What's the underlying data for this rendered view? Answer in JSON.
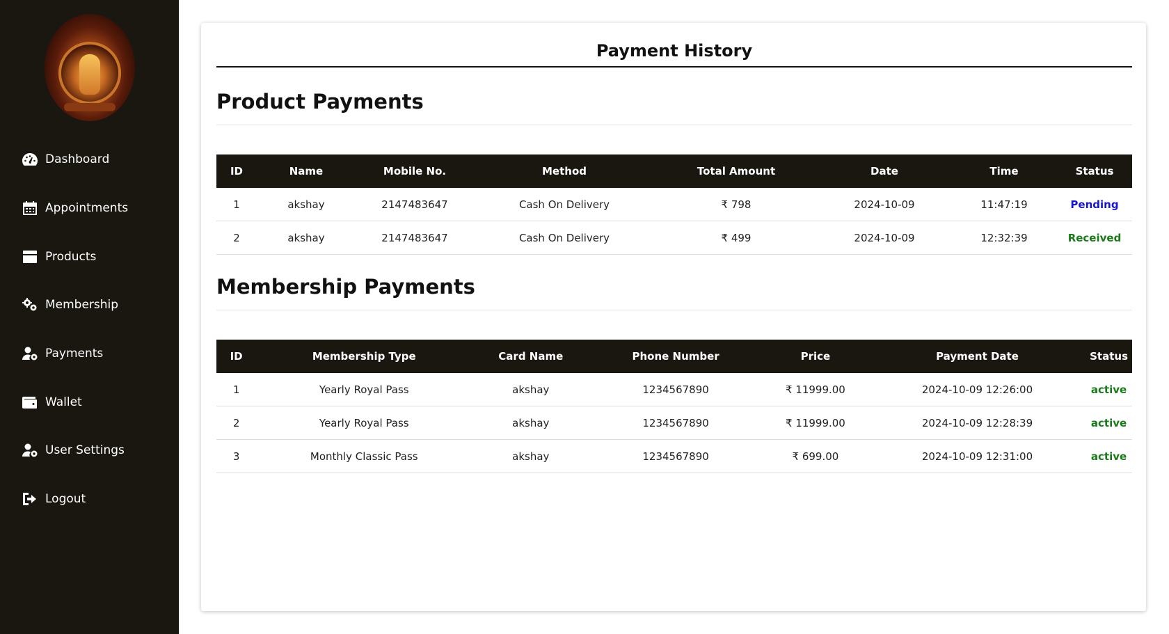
{
  "sidebar": {
    "items": [
      {
        "label": "Dashboard",
        "icon": "gauge-icon"
      },
      {
        "label": "Appointments",
        "icon": "calendar-icon"
      },
      {
        "label": "Products",
        "icon": "box-icon"
      },
      {
        "label": "Membership",
        "icon": "gears-icon"
      },
      {
        "label": "Payments",
        "icon": "user-gear-icon"
      },
      {
        "label": "Wallet",
        "icon": "wallet-icon"
      },
      {
        "label": "User Settings",
        "icon": "user-gear-icon"
      },
      {
        "label": "Logout",
        "icon": "logout-icon"
      }
    ]
  },
  "main": {
    "title": "Payment History",
    "product_section": {
      "title": "Product Payments",
      "headers": [
        "ID",
        "Name",
        "Mobile No.",
        "Method",
        "Total Amount",
        "Date",
        "Time",
        "Status"
      ],
      "rows": [
        {
          "id": "1",
          "name": "akshay",
          "mobile": "2147483647",
          "method": "Cash On Delivery",
          "amount": "₹ 798",
          "date": "2024-10-09",
          "time": "11:47:19",
          "status": "Pending"
        },
        {
          "id": "2",
          "name": "akshay",
          "mobile": "2147483647",
          "method": "Cash On Delivery",
          "amount": "₹ 499",
          "date": "2024-10-09",
          "time": "12:32:39",
          "status": "Received"
        }
      ]
    },
    "membership_section": {
      "title": "Membership Payments",
      "headers": [
        "ID",
        "Membership Type",
        "Card Name",
        "Phone Number",
        "Price",
        "Payment Date",
        "Status"
      ],
      "rows": [
        {
          "id": "1",
          "type": "Yearly Royal Pass",
          "card": "akshay",
          "phone": "1234567890",
          "price": "₹ 11999.00",
          "date": "2024-10-09 12:26:00",
          "status": "active"
        },
        {
          "id": "2",
          "type": "Yearly Royal Pass",
          "card": "akshay",
          "phone": "1234567890",
          "price": "₹ 11999.00",
          "date": "2024-10-09 12:28:39",
          "status": "active"
        },
        {
          "id": "3",
          "type": "Monthly Classic Pass",
          "card": "akshay",
          "phone": "1234567890",
          "price": "₹ 699.00",
          "date": "2024-10-09 12:31:00",
          "status": "active"
        }
      ]
    }
  },
  "colors": {
    "sidebar_bg": "#1a1710",
    "table_header_bg": "#1a1710",
    "pending": "#1515d4",
    "received": "#1a7a1a",
    "active": "#1a7a1a"
  }
}
